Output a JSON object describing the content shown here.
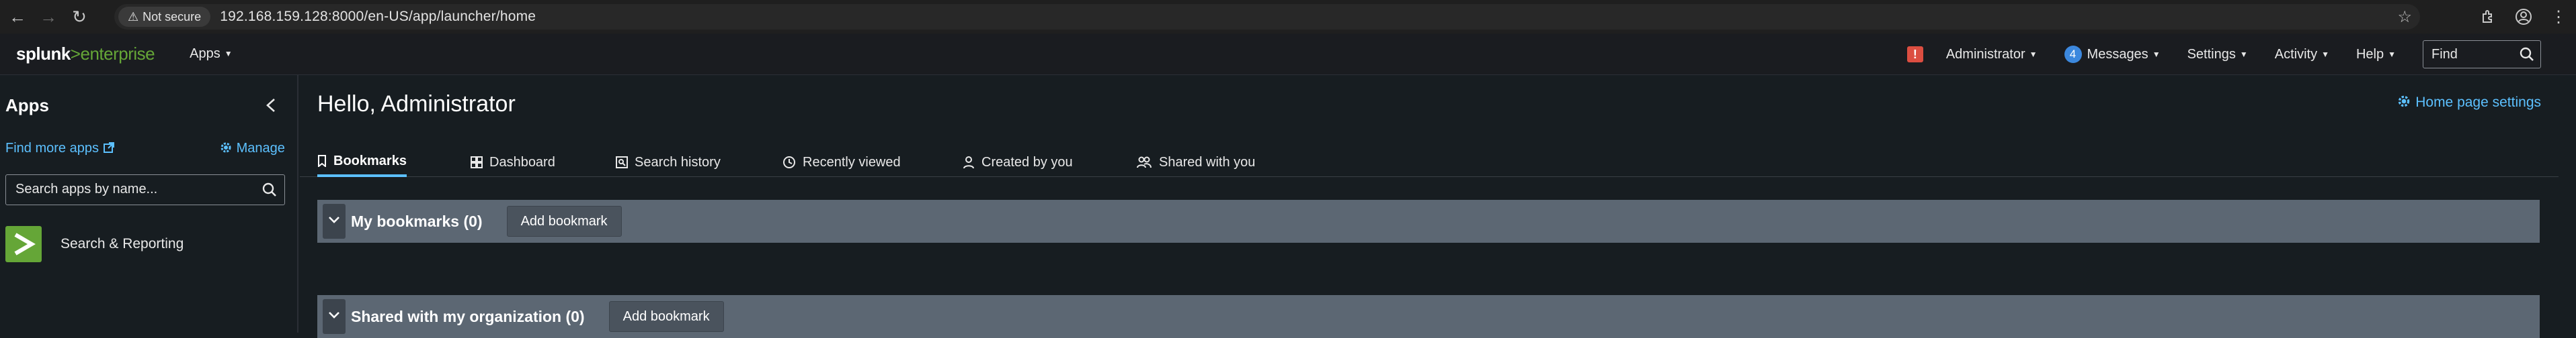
{
  "browser": {
    "not_secure_label": "Not secure",
    "url": "192.168.159.128:8000/en-US/app/launcher/home"
  },
  "splunkbar": {
    "logo_splunk": "splunk",
    "logo_gt": ">",
    "logo_enterprise": "enterprise",
    "apps_label": "Apps",
    "alert_label": "!",
    "user_label": "Administrator",
    "messages_count": "4",
    "messages_label": "Messages",
    "settings_label": "Settings",
    "activity_label": "Activity",
    "help_label": "Help",
    "find_placeholder": "Find"
  },
  "sidebar": {
    "title": "Apps",
    "find_more_label": "Find more apps",
    "manage_label": "Manage",
    "search_placeholder": "Search apps by name...",
    "apps": [
      {
        "name": "Search & Reporting"
      }
    ]
  },
  "main": {
    "greeting": "Hello, Administrator",
    "home_settings_label": "Home page settings",
    "tabs": [
      {
        "label": "Bookmarks",
        "active": true
      },
      {
        "label": "Dashboard"
      },
      {
        "label": "Search history"
      },
      {
        "label": "Recently viewed"
      },
      {
        "label": "Created by you"
      },
      {
        "label": "Shared with you"
      }
    ],
    "sections": [
      {
        "title": "My bookmarks (0)",
        "button_label": "Add bookmark"
      },
      {
        "title": "Shared with my organization (0)",
        "button_label": "Add bookmark"
      }
    ]
  },
  "colors": {
    "accent_link": "#5cc0ff",
    "brand_green": "#65a637",
    "alert_red": "#dc4e41",
    "badge_blue": "#3c88de",
    "section_bar": "#5c6773"
  }
}
